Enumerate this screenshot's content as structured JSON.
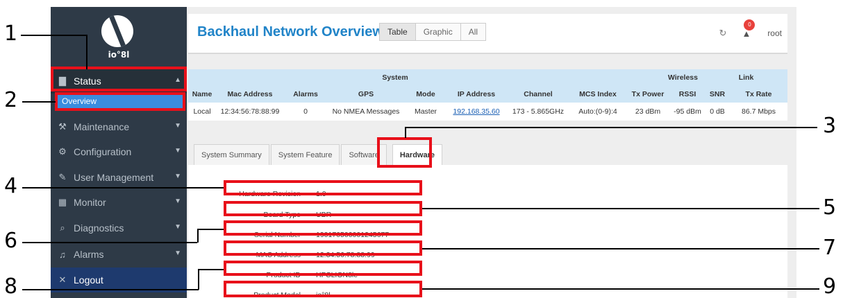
{
  "sidebar": {
    "logo_text": "io°8l",
    "items": [
      {
        "label": "Status",
        "icon": "bar-chart-icon"
      },
      {
        "label": "Overview"
      },
      {
        "label": "Maintenance",
        "icon": "wrench-icon"
      },
      {
        "label": "Configuration",
        "icon": "gear-icon"
      },
      {
        "label": "User Management",
        "icon": "pencil-icon"
      },
      {
        "label": "Monitor",
        "icon": "grid-icon"
      },
      {
        "label": "Diagnostics",
        "icon": "search-icon"
      },
      {
        "label": "Alarms",
        "icon": "bell-icon"
      },
      {
        "label": "Logout",
        "icon": "close-icon"
      }
    ]
  },
  "header": {
    "title": "Backhaul Network Overview",
    "tabs": [
      "Table",
      "Graphic",
      "All"
    ],
    "notification_count": "0",
    "user": "root"
  },
  "table": {
    "groups": [
      "System",
      "Wireless",
      "Link"
    ],
    "columns": [
      "Name",
      "Mac Address",
      "Alarms",
      "GPS",
      "Mode",
      "IP Address",
      "Channel",
      "MCS Index",
      "Tx Power",
      "RSSI",
      "SNR",
      "Tx Rate"
    ],
    "rows": [
      [
        "Local",
        "12:34:56:78:88:99",
        "0",
        "No NMEA Messages",
        "Master",
        "192.168.35.60",
        "173 - 5.865GHz",
        "Auto:(0-9):4",
        "23 dBm",
        "-95 dBm",
        "0 dB",
        "86.7 Mbps"
      ]
    ]
  },
  "detail_tabs": [
    "System Summary",
    "System Feature",
    "Software",
    "Hardware"
  ],
  "hardware": [
    {
      "label": "Hardware Revision",
      "value": "1.0"
    },
    {
      "label": "Board Type",
      "value": "UBR"
    },
    {
      "label": "Serial Number",
      "value": "190170500001245677"
    },
    {
      "label": "MAC Address",
      "value": "12:34:56:78:88:99"
    },
    {
      "label": "Product ID",
      "value": "HFCLION8le"
    },
    {
      "label": "Product Model",
      "value": "io°8l"
    }
  ],
  "callouts": [
    "1",
    "2",
    "3",
    "4",
    "5",
    "6",
    "7",
    "8",
    "9"
  ],
  "colors": {
    "accent": "#2184c8",
    "sidebar": "#2e3a47",
    "highlight": "#e8101a",
    "table_header": "#cfe6f6"
  }
}
